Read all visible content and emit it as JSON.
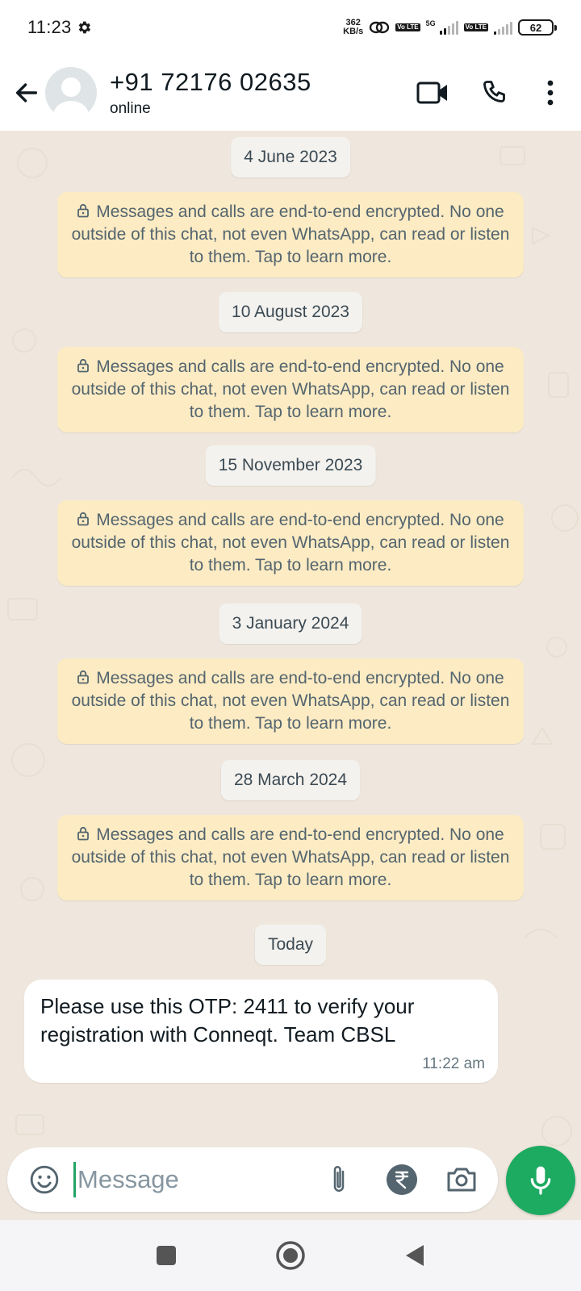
{
  "status_bar": {
    "time": "11:23",
    "net_speed_value": "362",
    "net_speed_unit": "KB/s",
    "lte1": "Vo LTE",
    "lte2": "Vo LTE",
    "five_g": "5G",
    "battery": "62"
  },
  "header": {
    "contact_name": "+91 72176 02635",
    "contact_status": "online",
    "icons": [
      "back-arrow-icon",
      "avatar",
      "video-call-icon",
      "phone-icon",
      "more-vert-icon"
    ]
  },
  "chat": {
    "items": [
      {
        "date": "4 June 2023",
        "notice": "Messages and calls are end-to-end encrypted. No one outside of this chat, not even WhatsApp, can read or listen to them. Tap to learn more."
      },
      {
        "date": "10 August 2023",
        "notice": "Messages and calls are end-to-end encrypted. No one outside of this chat, not even WhatsApp, can read or listen to them. Tap to learn more."
      },
      {
        "date": "15 November 2023",
        "notice": "Messages and calls are end-to-end encrypted. No one outside of this chat, not even WhatsApp, can read or listen to them. Tap to learn more."
      },
      {
        "date": "3 January 2024",
        "notice": "Messages and calls are end-to-end encrypted. No one outside of this chat, not even WhatsApp, can read or listen to them. Tap to learn more."
      },
      {
        "date": "28 March 2024",
        "notice": "Messages and calls are end-to-end encrypted. No one outside of this chat, not even WhatsApp, can read or listen to them. Tap to learn more."
      }
    ],
    "today_label": "Today",
    "message": {
      "text": "Please use this OTP: 2411 to verify your registration with Conneqt.  Team CBSL",
      "time": "11:22 am"
    }
  },
  "composer": {
    "placeholder": "Message",
    "value": "",
    "icons": [
      "emoji-icon",
      "attach-icon",
      "rupee-icon",
      "camera-icon",
      "mic-icon"
    ]
  },
  "nav_bar": {
    "icons": [
      "recents-icon",
      "home-icon",
      "back-icon"
    ]
  },
  "colors": {
    "chat_background": "#efe7dd",
    "encryption_notice": "#fcebc3",
    "date_chip": "#f4f2ee",
    "accent_green": "#1daa61"
  }
}
